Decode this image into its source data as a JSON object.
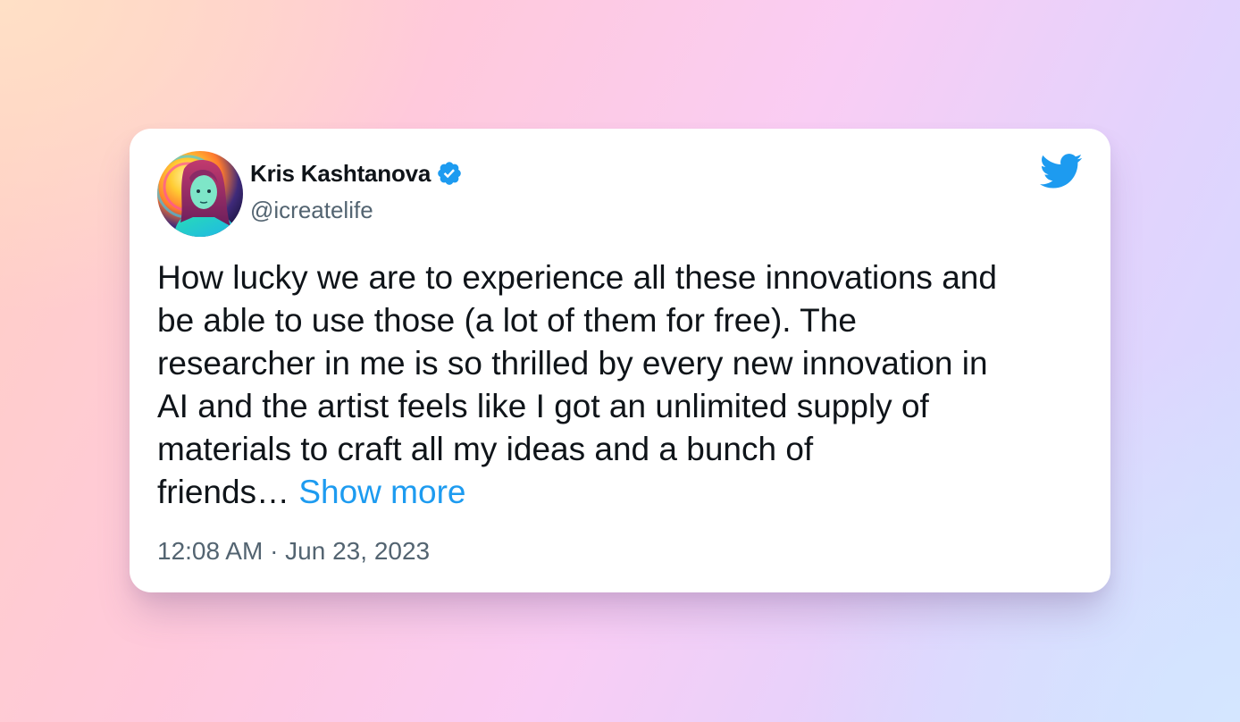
{
  "tweet": {
    "author_name": "Kris Kashtanova",
    "handle": "@icreatelife",
    "text_lines": [
      "How lucky we are to experience all these innovations and",
      "be able to use those (a lot of them for free). The",
      "researcher in me is so thrilled by every new innovation in",
      "AI and the artist feels like I got an unlimited supply of",
      "materials to craft all my ideas and a bunch of",
      "friends…"
    ],
    "show_more_label": "Show more",
    "timestamp": "12:08 AM · Jun 23, 2023"
  },
  "icons": {
    "verified": "verified-badge-icon",
    "platform": "twitter-bird-icon",
    "avatar": "avatar-image"
  },
  "colors": {
    "text_primary": "#0f1419",
    "text_secondary": "#536471",
    "accent_blue": "#1d9bf0",
    "card_background": "#ffffff"
  }
}
